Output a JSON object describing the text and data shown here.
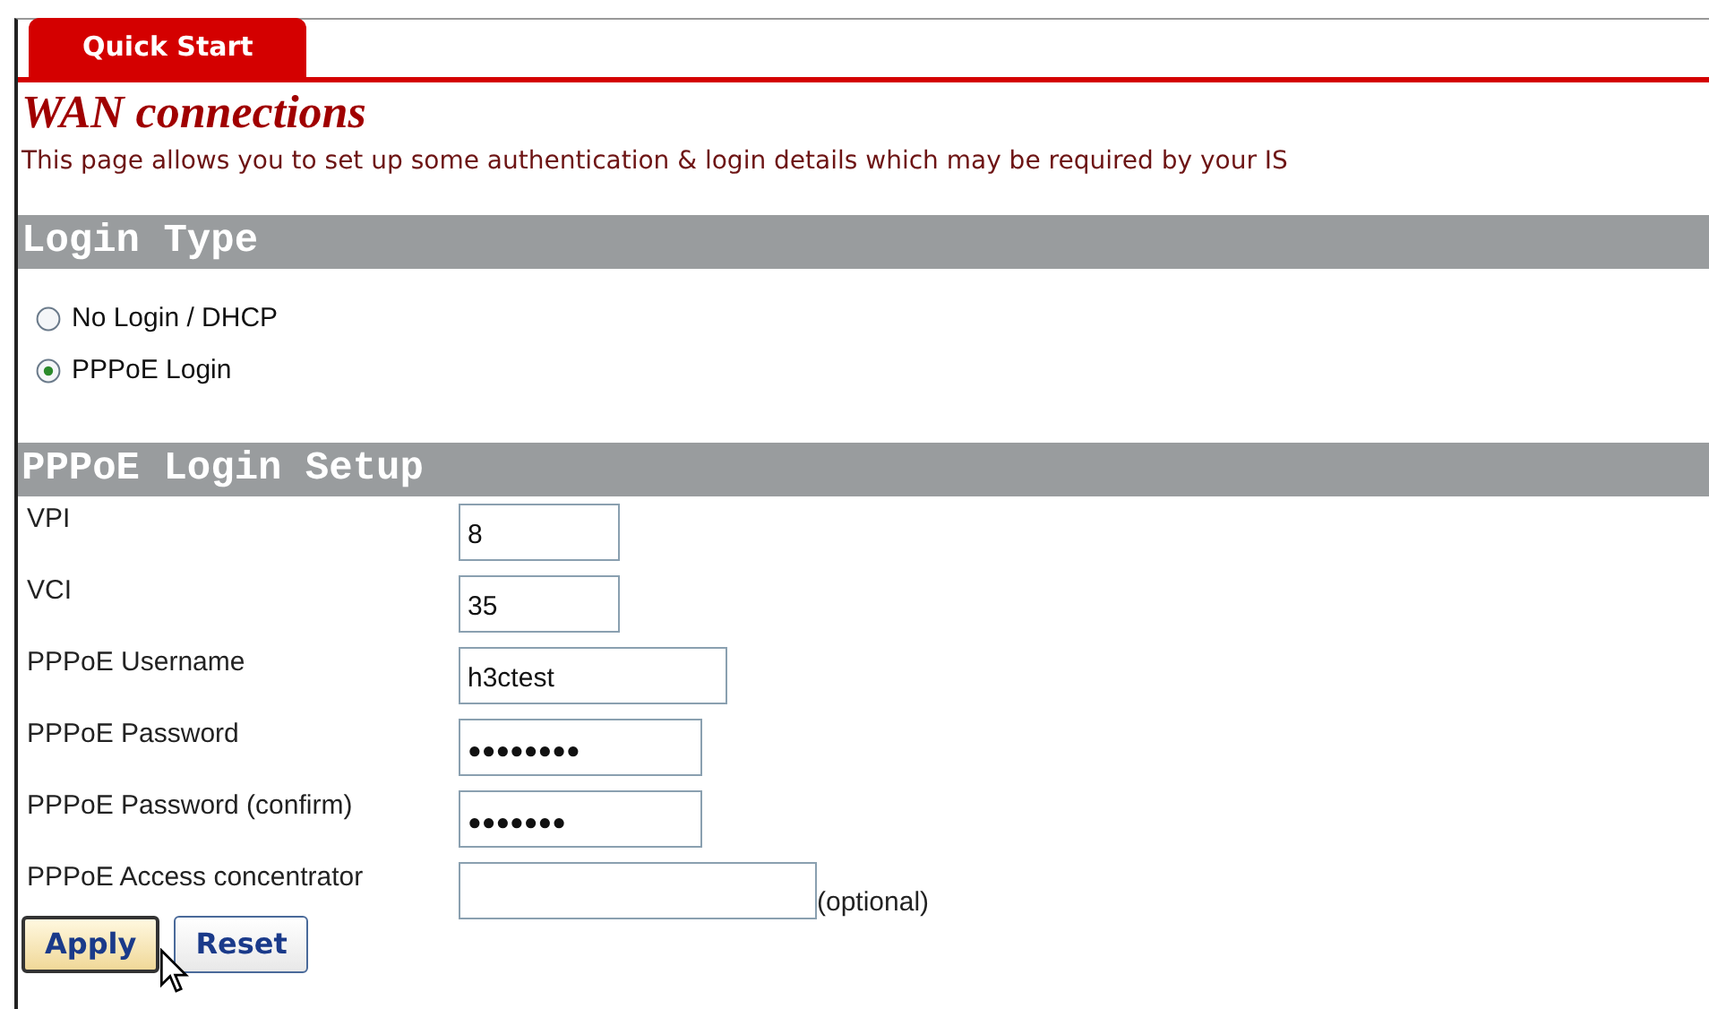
{
  "tabs": [
    {
      "label": "Quick Start",
      "selected": true
    }
  ],
  "title": "WAN connections",
  "description": "This page allows you to set up some authentication & login details which may be required by your IS",
  "sections": [
    {
      "heading": "Login Type",
      "kind": "radios",
      "options": [
        {
          "label": "No Login / DHCP",
          "selected": false
        },
        {
          "label": "PPPoE Login",
          "selected": true
        }
      ]
    },
    {
      "heading": "PPPoE Login Setup",
      "kind": "fields",
      "fields": [
        {
          "label": "VPI",
          "value": "8",
          "kind": "text"
        },
        {
          "label": "VCI",
          "value": "35",
          "kind": "text"
        },
        {
          "label": "PPPoE Username",
          "value": "h3ctest",
          "kind": "text"
        },
        {
          "label": "PPPoE Password",
          "value": "●●●●●●●●",
          "kind": "password"
        },
        {
          "label": "PPPoE Password (confirm)",
          "value": "●●●●●●●",
          "kind": "password"
        },
        {
          "label": "PPPoE Access concentrator",
          "kind": "text",
          "note": "(optional)"
        }
      ]
    }
  ],
  "buttons": [
    {
      "label": "Apply",
      "focused": true
    },
    {
      "label": "Reset",
      "focused": false
    }
  ]
}
